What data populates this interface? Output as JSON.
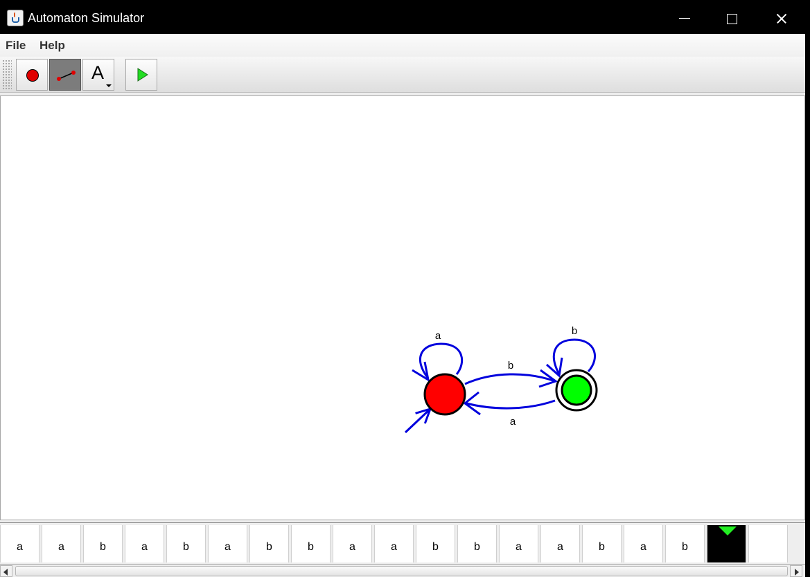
{
  "window": {
    "title": "Automaton Simulator",
    "icon": "java-cup-icon"
  },
  "menu": {
    "items": [
      "File",
      "Help"
    ]
  },
  "toolbar": {
    "buttons": [
      {
        "name": "add-state-tool",
        "icon": "red-circle-icon"
      },
      {
        "name": "add-transition-tool",
        "icon": "transition-line-icon",
        "pressed": true
      },
      {
        "name": "label-tool",
        "icon": "letter-a-icon",
        "glyph": "A"
      },
      {
        "name": "run-button",
        "icon": "green-play-icon"
      }
    ]
  },
  "automaton": {
    "states": [
      {
        "id": "q0",
        "initial": true,
        "accepting": false,
        "color": "#ff0000"
      },
      {
        "id": "q1",
        "initial": false,
        "accepting": true,
        "color": "#00ff00"
      }
    ],
    "transitions": [
      {
        "from": "q0",
        "to": "q0",
        "label": "a"
      },
      {
        "from": "q0",
        "to": "q1",
        "label": "b"
      },
      {
        "from": "q1",
        "to": "q0",
        "label": "a"
      },
      {
        "from": "q1",
        "to": "q1",
        "label": "b"
      }
    ],
    "edge_color": "#0000dd"
  },
  "tape": {
    "cells": [
      "a",
      "a",
      "b",
      "a",
      "b",
      "a",
      "b",
      "b",
      "a",
      "a",
      "b",
      "b",
      "a",
      "a",
      "b",
      "a",
      "b",
      "",
      ""
    ],
    "head_index": 17,
    "head_color": "#22ee22"
  }
}
